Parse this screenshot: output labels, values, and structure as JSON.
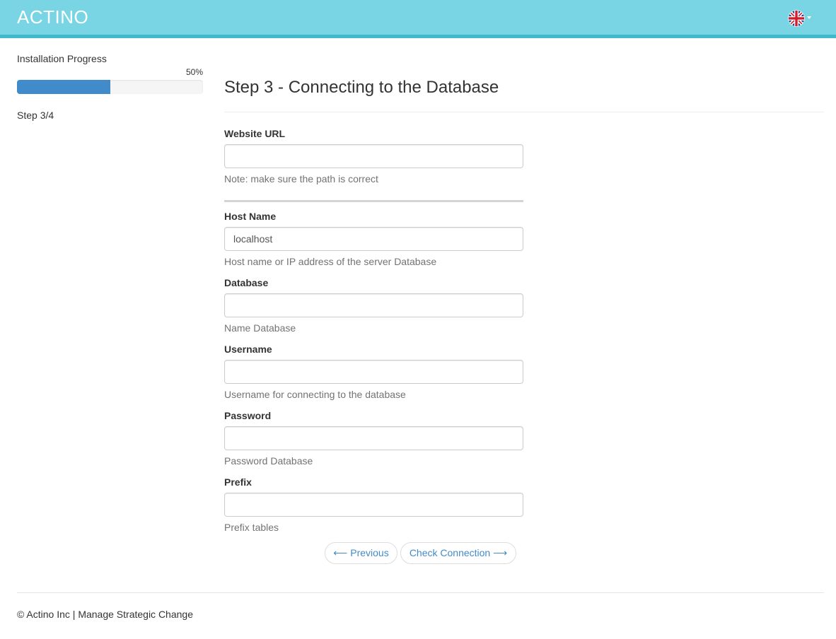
{
  "header": {
    "brand": "ACTINO",
    "language_icon": "uk-flag-icon"
  },
  "sidebar": {
    "title": "Installation Progress",
    "progress_label": "50%",
    "progress_value": 0.5,
    "step_label": "Step 3/4"
  },
  "main": {
    "title": "Step 3 - Connecting to the Database",
    "fields": {
      "website_url": {
        "label": "Website URL",
        "value": "",
        "help": "Note: make sure the path is correct"
      },
      "host_name": {
        "label": "Host Name",
        "value": "localhost",
        "help": "Host name or IP address of the server Database"
      },
      "database": {
        "label": "Database",
        "value": "",
        "help": "Name Database"
      },
      "username": {
        "label": "Username",
        "value": "",
        "help": "Username for connecting to the database"
      },
      "password": {
        "label": "Password",
        "value": "",
        "help": "Password Database"
      },
      "prefix": {
        "label": "Prefix",
        "value": "",
        "help": "Prefix tables"
      }
    },
    "buttons": {
      "previous": "⟵ Previous",
      "check_connection": "Check Connection ⟶"
    }
  },
  "footer": {
    "text": "© Actino Inc | Manage Strategic Change"
  },
  "colors": {
    "header_bg": "#79d5e3",
    "header_border": "#3fb9cb",
    "progress_fill": "#428bca",
    "link": "#428bca"
  }
}
